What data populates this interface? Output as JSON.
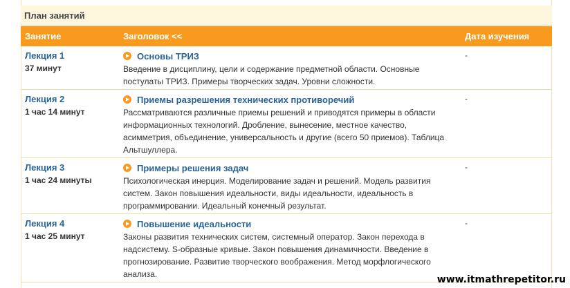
{
  "panel": {
    "title": "План занятий"
  },
  "header": {
    "col_lesson": "Занятие",
    "col_title": "Заголовок <<",
    "col_date": "Дата изучения"
  },
  "lectures": [
    {
      "label": "Лекция 1",
      "duration": "37 минут",
      "title": "Основы ТРИЗ",
      "desc_lines": [
        "Введение в дисциплину, цели и содержание предметной области. Основные",
        "постулаты ТРИЗ. Примеры творческих задач. Уровни сложности."
      ],
      "date": "-"
    },
    {
      "label": "Лекция 2",
      "duration": "1 час 14 минут",
      "title": "Приемы разрешения технических противоречий",
      "desc_lines": [
        "Рассматриваются различные приемы решений и приводятся примеры в области",
        "информационных технологий. Дробление, вынесение, местное качество,",
        "асимметрия, объединение, универсальность и другие (всего 50 приемов). Таблица",
        "Альтшуллера."
      ],
      "date": "-"
    },
    {
      "label": "Лекция 3",
      "duration": "1 час 24 минуты",
      "title": "Примеры решения задач",
      "desc_lines": [
        "Психологическая инерция. Моделирование задач и решений. Модель развития",
        "систем. Закон повышения идеальности, виды идеальности, идеальность в",
        "программировании. Идеальный конечный результат."
      ],
      "date": "-"
    },
    {
      "label": "Лекция 4",
      "duration": "1 час 25 минут",
      "title": "Повышение идеальности",
      "desc_lines": [
        "Законы развития технических систем, системный оператор. Закон перехода в",
        "надсистему. S-образные кривые. Закон повышения динамичности. Введение в",
        "прогнозирование. Развитие творческого воображения. Метод морфлогического",
        "анализа."
      ],
      "date": "-"
    }
  ],
  "watermark": "www.itmathrepetitor.ru"
}
